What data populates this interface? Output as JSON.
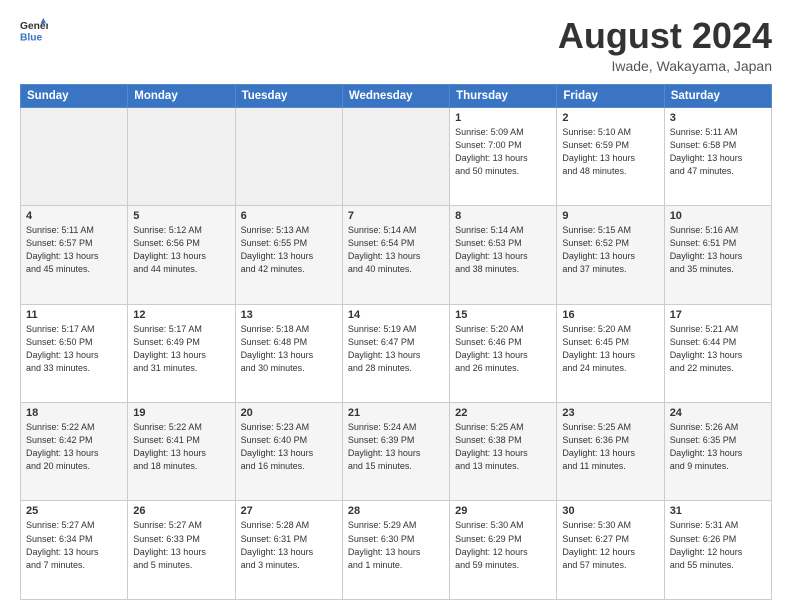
{
  "header": {
    "logo_line1": "General",
    "logo_line2": "Blue",
    "title": "August 2024",
    "subtitle": "Iwade, Wakayama, Japan"
  },
  "weekdays": [
    "Sunday",
    "Monday",
    "Tuesday",
    "Wednesday",
    "Thursday",
    "Friday",
    "Saturday"
  ],
  "weeks": [
    [
      {
        "day": "",
        "info": ""
      },
      {
        "day": "",
        "info": ""
      },
      {
        "day": "",
        "info": ""
      },
      {
        "day": "",
        "info": ""
      },
      {
        "day": "1",
        "info": "Sunrise: 5:09 AM\nSunset: 7:00 PM\nDaylight: 13 hours\nand 50 minutes."
      },
      {
        "day": "2",
        "info": "Sunrise: 5:10 AM\nSunset: 6:59 PM\nDaylight: 13 hours\nand 48 minutes."
      },
      {
        "day": "3",
        "info": "Sunrise: 5:11 AM\nSunset: 6:58 PM\nDaylight: 13 hours\nand 47 minutes."
      }
    ],
    [
      {
        "day": "4",
        "info": "Sunrise: 5:11 AM\nSunset: 6:57 PM\nDaylight: 13 hours\nand 45 minutes."
      },
      {
        "day": "5",
        "info": "Sunrise: 5:12 AM\nSunset: 6:56 PM\nDaylight: 13 hours\nand 44 minutes."
      },
      {
        "day": "6",
        "info": "Sunrise: 5:13 AM\nSunset: 6:55 PM\nDaylight: 13 hours\nand 42 minutes."
      },
      {
        "day": "7",
        "info": "Sunrise: 5:14 AM\nSunset: 6:54 PM\nDaylight: 13 hours\nand 40 minutes."
      },
      {
        "day": "8",
        "info": "Sunrise: 5:14 AM\nSunset: 6:53 PM\nDaylight: 13 hours\nand 38 minutes."
      },
      {
        "day": "9",
        "info": "Sunrise: 5:15 AM\nSunset: 6:52 PM\nDaylight: 13 hours\nand 37 minutes."
      },
      {
        "day": "10",
        "info": "Sunrise: 5:16 AM\nSunset: 6:51 PM\nDaylight: 13 hours\nand 35 minutes."
      }
    ],
    [
      {
        "day": "11",
        "info": "Sunrise: 5:17 AM\nSunset: 6:50 PM\nDaylight: 13 hours\nand 33 minutes."
      },
      {
        "day": "12",
        "info": "Sunrise: 5:17 AM\nSunset: 6:49 PM\nDaylight: 13 hours\nand 31 minutes."
      },
      {
        "day": "13",
        "info": "Sunrise: 5:18 AM\nSunset: 6:48 PM\nDaylight: 13 hours\nand 30 minutes."
      },
      {
        "day": "14",
        "info": "Sunrise: 5:19 AM\nSunset: 6:47 PM\nDaylight: 13 hours\nand 28 minutes."
      },
      {
        "day": "15",
        "info": "Sunrise: 5:20 AM\nSunset: 6:46 PM\nDaylight: 13 hours\nand 26 minutes."
      },
      {
        "day": "16",
        "info": "Sunrise: 5:20 AM\nSunset: 6:45 PM\nDaylight: 13 hours\nand 24 minutes."
      },
      {
        "day": "17",
        "info": "Sunrise: 5:21 AM\nSunset: 6:44 PM\nDaylight: 13 hours\nand 22 minutes."
      }
    ],
    [
      {
        "day": "18",
        "info": "Sunrise: 5:22 AM\nSunset: 6:42 PM\nDaylight: 13 hours\nand 20 minutes."
      },
      {
        "day": "19",
        "info": "Sunrise: 5:22 AM\nSunset: 6:41 PM\nDaylight: 13 hours\nand 18 minutes."
      },
      {
        "day": "20",
        "info": "Sunrise: 5:23 AM\nSunset: 6:40 PM\nDaylight: 13 hours\nand 16 minutes."
      },
      {
        "day": "21",
        "info": "Sunrise: 5:24 AM\nSunset: 6:39 PM\nDaylight: 13 hours\nand 15 minutes."
      },
      {
        "day": "22",
        "info": "Sunrise: 5:25 AM\nSunset: 6:38 PM\nDaylight: 13 hours\nand 13 minutes."
      },
      {
        "day": "23",
        "info": "Sunrise: 5:25 AM\nSunset: 6:36 PM\nDaylight: 13 hours\nand 11 minutes."
      },
      {
        "day": "24",
        "info": "Sunrise: 5:26 AM\nSunset: 6:35 PM\nDaylight: 13 hours\nand 9 minutes."
      }
    ],
    [
      {
        "day": "25",
        "info": "Sunrise: 5:27 AM\nSunset: 6:34 PM\nDaylight: 13 hours\nand 7 minutes."
      },
      {
        "day": "26",
        "info": "Sunrise: 5:27 AM\nSunset: 6:33 PM\nDaylight: 13 hours\nand 5 minutes."
      },
      {
        "day": "27",
        "info": "Sunrise: 5:28 AM\nSunset: 6:31 PM\nDaylight: 13 hours\nand 3 minutes."
      },
      {
        "day": "28",
        "info": "Sunrise: 5:29 AM\nSunset: 6:30 PM\nDaylight: 13 hours\nand 1 minute."
      },
      {
        "day": "29",
        "info": "Sunrise: 5:30 AM\nSunset: 6:29 PM\nDaylight: 12 hours\nand 59 minutes."
      },
      {
        "day": "30",
        "info": "Sunrise: 5:30 AM\nSunset: 6:27 PM\nDaylight: 12 hours\nand 57 minutes."
      },
      {
        "day": "31",
        "info": "Sunrise: 5:31 AM\nSunset: 6:26 PM\nDaylight: 12 hours\nand 55 minutes."
      }
    ]
  ]
}
